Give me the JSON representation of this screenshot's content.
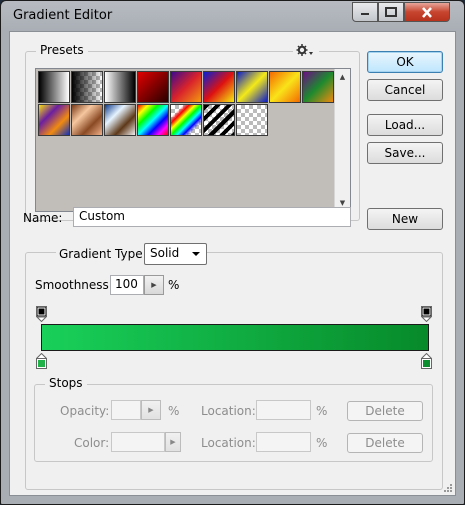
{
  "window": {
    "title": "Gradient Editor"
  },
  "titlebar": {
    "minimize_icon": "minimize-icon",
    "maximize_icon": "maximize-icon",
    "close_icon": "close-icon"
  },
  "presets": {
    "label": "Presets",
    "menu_icon": "gear-icon",
    "swatches": [
      {
        "name": "black-white"
      },
      {
        "name": "fg-transparent"
      },
      {
        "name": "white-black"
      },
      {
        "name": "red-black"
      },
      {
        "name": "violet-orange"
      },
      {
        "name": "blue-red-yellow"
      },
      {
        "name": "blue-yellow-blue"
      },
      {
        "name": "orange-yellow-orange"
      },
      {
        "name": "violet-green-orange"
      },
      {
        "name": "yellow-violet-orange-blue"
      },
      {
        "name": "copper"
      },
      {
        "name": "chrome"
      },
      {
        "name": "spectrum"
      },
      {
        "name": "transparent-rainbow"
      },
      {
        "name": "transparent-stripes"
      },
      {
        "name": "transparent-white"
      }
    ]
  },
  "buttons": {
    "ok": "OK",
    "cancel": "Cancel",
    "load": "Load...",
    "save": "Save...",
    "new": "New"
  },
  "name_field": {
    "label": "Name:",
    "value": "Custom"
  },
  "gradient_type": {
    "label": "Gradient Type:",
    "value": "Solid"
  },
  "smoothness": {
    "label": "Smoothness:",
    "value": "100",
    "unit": "%"
  },
  "gradient": {
    "colors": [
      "#19d05a",
      "#078a2a"
    ]
  },
  "stops": {
    "label": "Stops",
    "opacity_label": "Opacity:",
    "opacity_unit": "%",
    "color_label": "Color:",
    "location_label": "Location:",
    "location_unit": "%",
    "delete_label": "Delete"
  },
  "colors": {
    "stop_color_left": "#21b34a",
    "stop_color_right": "#0b8f2e"
  }
}
